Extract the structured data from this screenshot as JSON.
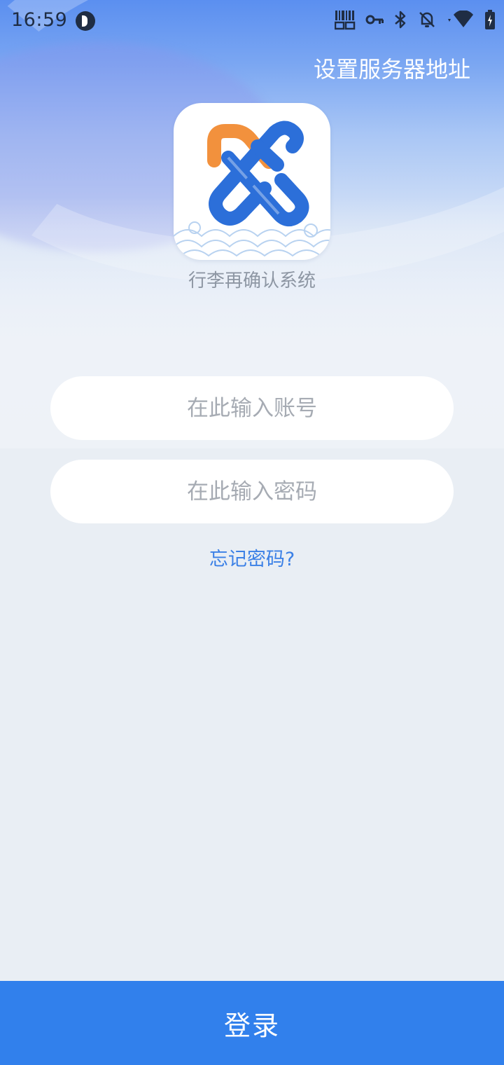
{
  "status_bar": {
    "time": "16:59",
    "icons": [
      "app-notification-icon",
      "barcode-icon",
      "vpn-key-icon",
      "bluetooth-icon",
      "notifications-off-icon",
      "wifi-icon",
      "battery-charging-icon"
    ]
  },
  "header": {
    "settings_label": "设置服务器地址"
  },
  "app": {
    "name": "行李再确认系统"
  },
  "form": {
    "account_placeholder": "在此输入账号",
    "account_value": "",
    "password_placeholder": "在此输入密码",
    "password_value": "",
    "forgot_label": "忘记密码?"
  },
  "footer": {
    "login_label": "登录"
  },
  "colors": {
    "accent": "#3180ec",
    "link": "#3b80e6",
    "logo_orange": "#f2913d",
    "logo_blue": "#2c6fd9"
  }
}
